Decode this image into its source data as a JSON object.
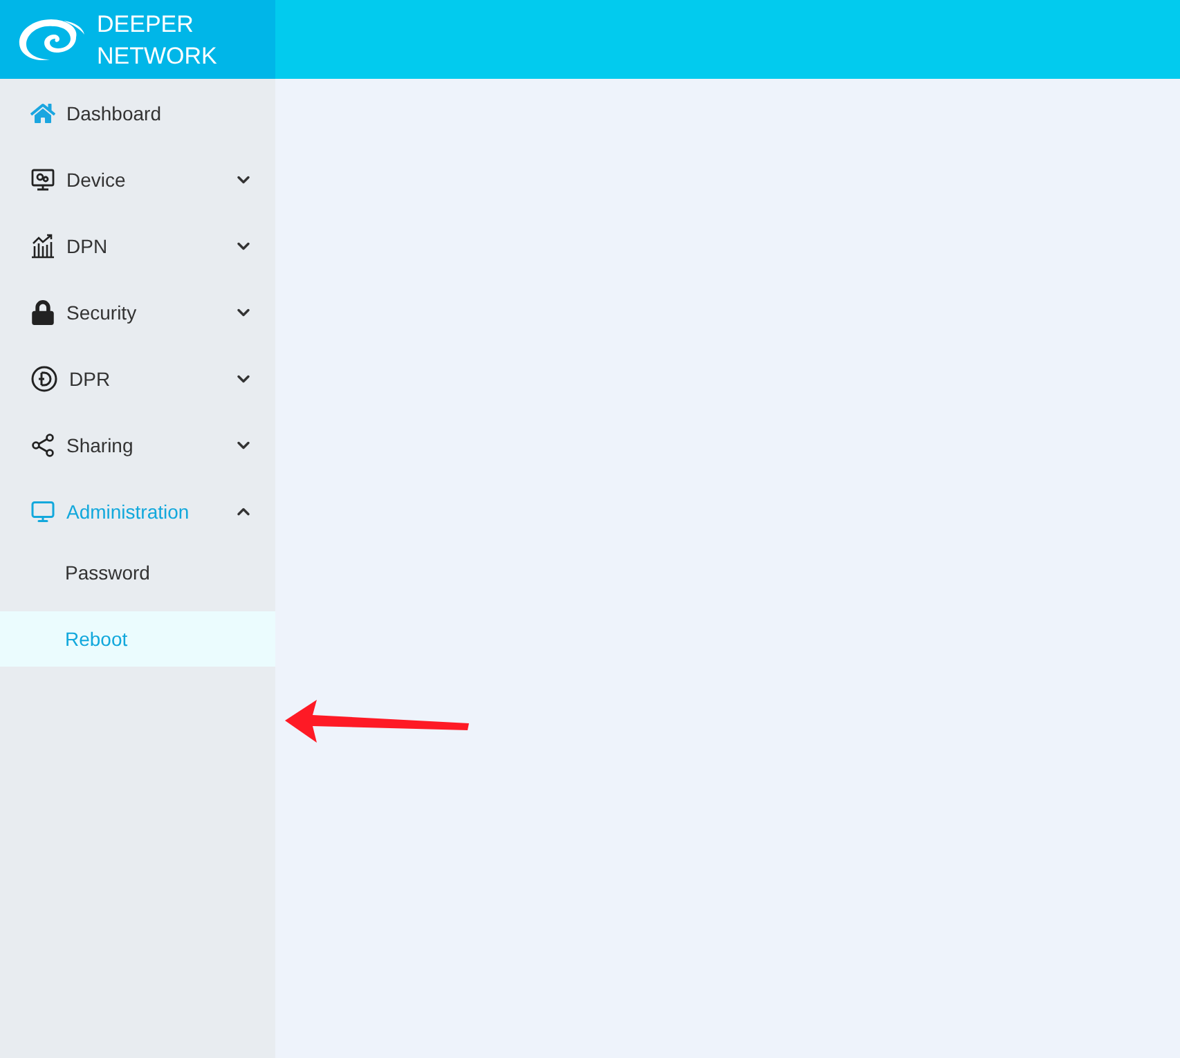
{
  "brand": {
    "line_1": "DEEPER",
    "line_2": "NETWORK"
  },
  "sidebar": {
    "items": [
      {
        "label": "Dashboard",
        "kind": "link",
        "selected": false
      },
      {
        "label": "Device",
        "kind": "group",
        "expanded": false,
        "selected": false
      },
      {
        "label": "DPN",
        "kind": "group",
        "expanded": false,
        "selected": false
      },
      {
        "label": "Security",
        "kind": "group",
        "expanded": false,
        "selected": false
      },
      {
        "label": "DPR",
        "kind": "group",
        "expanded": false,
        "selected": false
      },
      {
        "label": "Sharing",
        "kind": "group",
        "expanded": false,
        "selected": false
      },
      {
        "label": "Administration",
        "kind": "group",
        "expanded": true,
        "selected": true,
        "children": [
          {
            "label": "Password",
            "selected": false
          },
          {
            "label": "Reboot",
            "selected": true
          }
        ]
      }
    ]
  }
}
